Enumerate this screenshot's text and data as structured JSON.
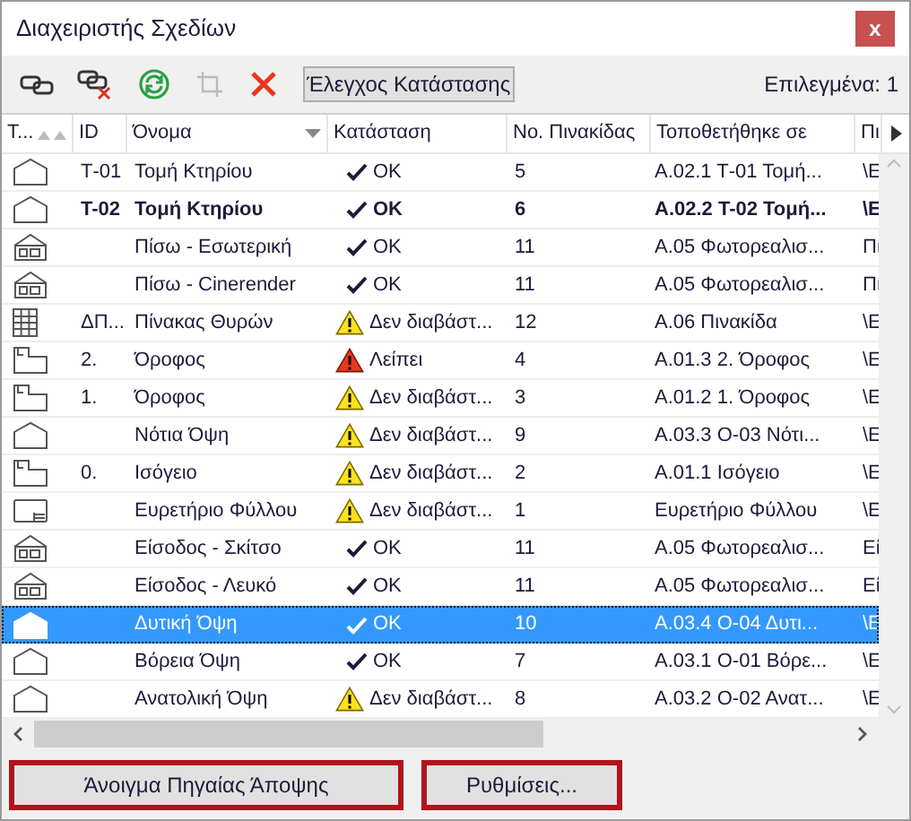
{
  "window": {
    "title": "Διαχειριστής Σχεδίων",
    "close": "x"
  },
  "toolbar": {
    "check_button": "Έλεγχος Κατάστασης",
    "selection_label": "Επιλεγμένα:",
    "selection_count": "1"
  },
  "table": {
    "columns": [
      "Τ...",
      "ID",
      "Όνομα",
      "Κατάσταση",
      "Νο. Πινακίδας",
      "Τοποθετήθηκε σε",
      "Πι"
    ],
    "rows": [
      {
        "kind": "section",
        "id": "Τ-01",
        "name": "Τομή Κτηρίου",
        "status": {
          "kind": "ok",
          "text": "ΟΚ"
        },
        "number": "5",
        "placed": "Α.02.1 Τ-01 Τομή...",
        "column_7": "\\Ε",
        "emphasized": false,
        "selected": false
      },
      {
        "kind": "section",
        "id": "Τ-02",
        "name": "Τομή Κτηρίου",
        "status": {
          "kind": "ok",
          "text": "ΟΚ"
        },
        "number": "6",
        "placed": "Α.02.2 Τ-02 Τομή...",
        "column_7": "\\Ε",
        "emphasized": true,
        "selected": false
      },
      {
        "kind": "render",
        "id": "",
        "name": "Πίσω - Εσωτερική",
        "status": {
          "kind": "ok",
          "text": "ΟΚ"
        },
        "number": "11",
        "placed": "Α.05 Φωτορεαλισ...",
        "column_7": "Πί",
        "emphasized": false,
        "selected": false
      },
      {
        "kind": "render",
        "id": "",
        "name": "Πίσω - Cinerender",
        "status": {
          "kind": "ok",
          "text": "ΟΚ"
        },
        "number": "11",
        "placed": "Α.05 Φωτορεαλισ...",
        "column_7": "Πί",
        "emphasized": false,
        "selected": false
      },
      {
        "kind": "schedule",
        "id": "ΔΠ...",
        "name": "Πίνακας Θυρών",
        "status": {
          "kind": "warning",
          "text": "Δεν διαβάστ..."
        },
        "number": "12",
        "placed": "Α.06 Πινακίδα",
        "column_7": "\\Ε",
        "emphasized": false,
        "selected": false
      },
      {
        "kind": "plan",
        "id": "2.",
        "name": "Όροφος",
        "status": {
          "kind": "missing",
          "text": "Λείπει"
        },
        "number": "4",
        "placed": "Α.01.3 2. Όροφος",
        "column_7": "\\Ε",
        "emphasized": false,
        "selected": false
      },
      {
        "kind": "plan",
        "id": "1.",
        "name": "Όροφος",
        "status": {
          "kind": "warning",
          "text": "Δεν διαβάστ..."
        },
        "number": "3",
        "placed": "Α.01.2 1. Όροφος",
        "column_7": "\\Ε",
        "emphasized": false,
        "selected": false
      },
      {
        "kind": "section",
        "id": "",
        "name": "Νότια Όψη",
        "status": {
          "kind": "warning",
          "text": "Δεν διαβάστ..."
        },
        "number": "9",
        "placed": "Α.03.3 Ο-03 Νότι...",
        "column_7": "\\Ε",
        "emphasized": false,
        "selected": false
      },
      {
        "kind": "plan",
        "id": "0.",
        "name": "Ισόγειο",
        "status": {
          "kind": "warning",
          "text": "Δεν διαβάστ..."
        },
        "number": "2",
        "placed": "Α.01.1 Ισόγειο",
        "column_7": "\\Ε",
        "emphasized": false,
        "selected": false
      },
      {
        "kind": "layout",
        "id": "",
        "name": "Ευρετήριο Φύλλου",
        "status": {
          "kind": "warning",
          "text": "Δεν διαβάστ..."
        },
        "number": "1",
        "placed": "Ευρετήριο Φύλλου",
        "column_7": "\\Ε",
        "emphasized": false,
        "selected": false
      },
      {
        "kind": "render",
        "id": "",
        "name": "Είσοδος - Σκίτσο",
        "status": {
          "kind": "ok",
          "text": "ΟΚ"
        },
        "number": "11",
        "placed": "Α.05 Φωτορεαλισ...",
        "column_7": "Εί",
        "emphasized": false,
        "selected": false
      },
      {
        "kind": "render",
        "id": "",
        "name": "Είσοδος - Λευκό",
        "status": {
          "kind": "ok",
          "text": "ΟΚ"
        },
        "number": "11",
        "placed": "Α.05 Φωτορεαλισ...",
        "column_7": "Εί",
        "emphasized": false,
        "selected": false
      },
      {
        "kind": "section",
        "id": "",
        "name": "Δυτική Όψη",
        "status": {
          "kind": "ok",
          "text": "ΟΚ"
        },
        "number": "10",
        "placed": "Α.03.4 Ο-04 Δυτι...",
        "column_7": "\\Ε",
        "emphasized": false,
        "selected": true
      },
      {
        "kind": "section",
        "id": "",
        "name": "Βόρεια Όψη",
        "status": {
          "kind": "ok",
          "text": "ΟΚ"
        },
        "number": "7",
        "placed": "Α.03.1 Ο-01 Βόρε...",
        "column_7": "\\Ε",
        "emphasized": false,
        "selected": false
      },
      {
        "kind": "section",
        "id": "",
        "name": "Ανατολική Όψη",
        "status": {
          "kind": "warning",
          "text": "Δεν διαβάστ..."
        },
        "number": "8",
        "placed": "Α.03.2 Ο-02 Ανατ...",
        "column_7": "\\Ε",
        "emphasized": false,
        "selected": false
      }
    ]
  },
  "buttons": [
    "Άνοιγμα Πηγαίας Άποψης",
    "Ρυθμίσεις..."
  ]
}
